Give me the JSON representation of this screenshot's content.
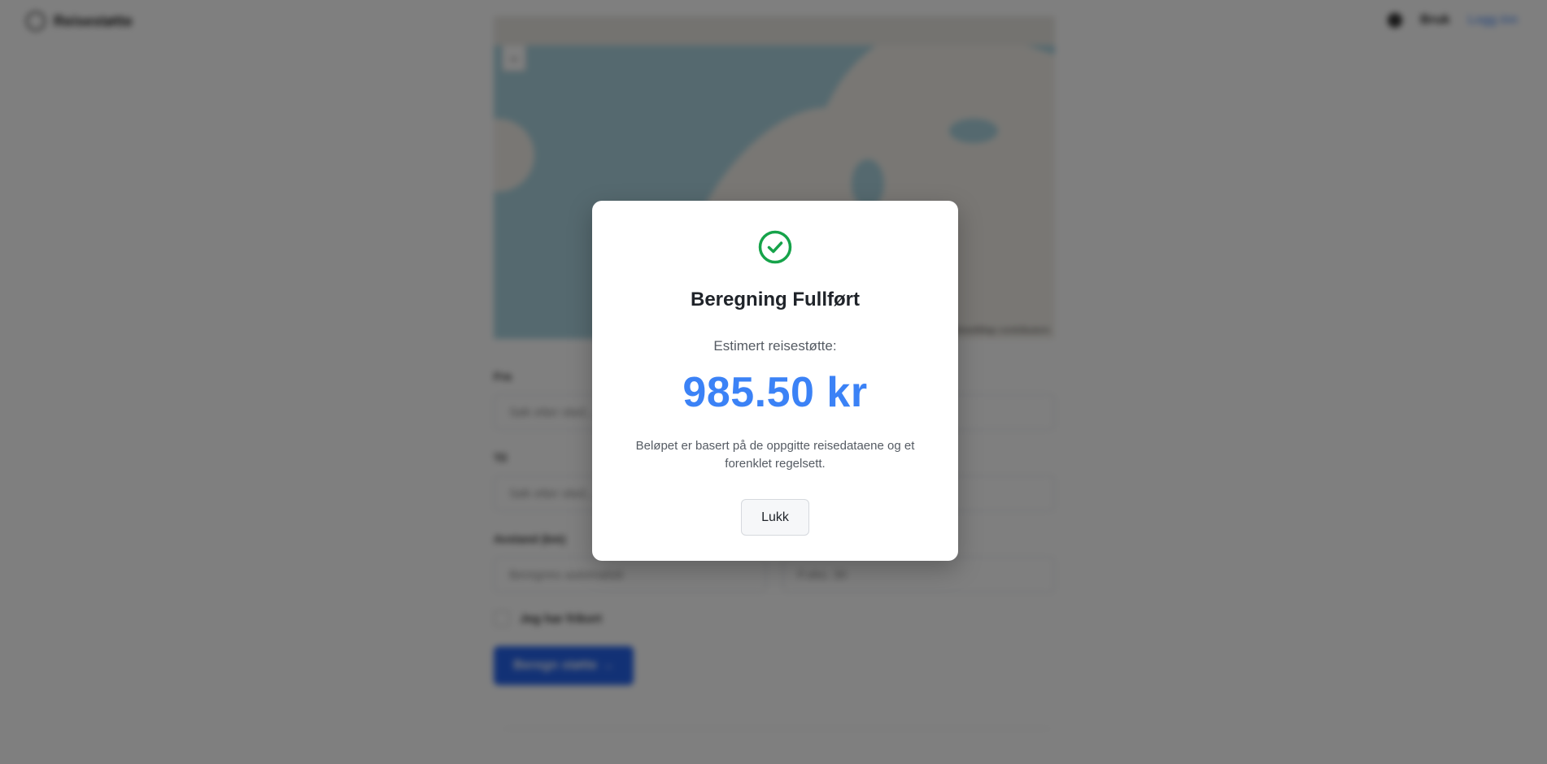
{
  "header": {
    "app_name": "Reisestøtte",
    "user_label": "Bruk",
    "login_label": "Logg inn"
  },
  "map": {
    "zoom_in": "+",
    "zoom_out": "−",
    "attribution": "© OpenStreetMap contributors"
  },
  "form": {
    "from_label": "Fra",
    "from_placeholder": "Søk etter sted...",
    "to_label": "Til",
    "to_placeholder": "Søk etter sted...",
    "distance_label": "Avstand (km)",
    "distance_placeholder": "Beregnes automatisk",
    "days_placeholder": "F.eks. 30",
    "checkbox_label": "Jeg har frikort",
    "submit_label": "Beregn støtte →"
  },
  "modal": {
    "title": "Beregning Fullført",
    "subtitle": "Estimert reisestøtte:",
    "amount": "985.50 kr",
    "note": "Beløpet er basert på de oppgitte reisedataene og et forenklet regelsett.",
    "close_label": "Lukk",
    "icon": "check-circle-icon",
    "icon_color": "#16a34a",
    "amount_color": "#3b82f6"
  }
}
